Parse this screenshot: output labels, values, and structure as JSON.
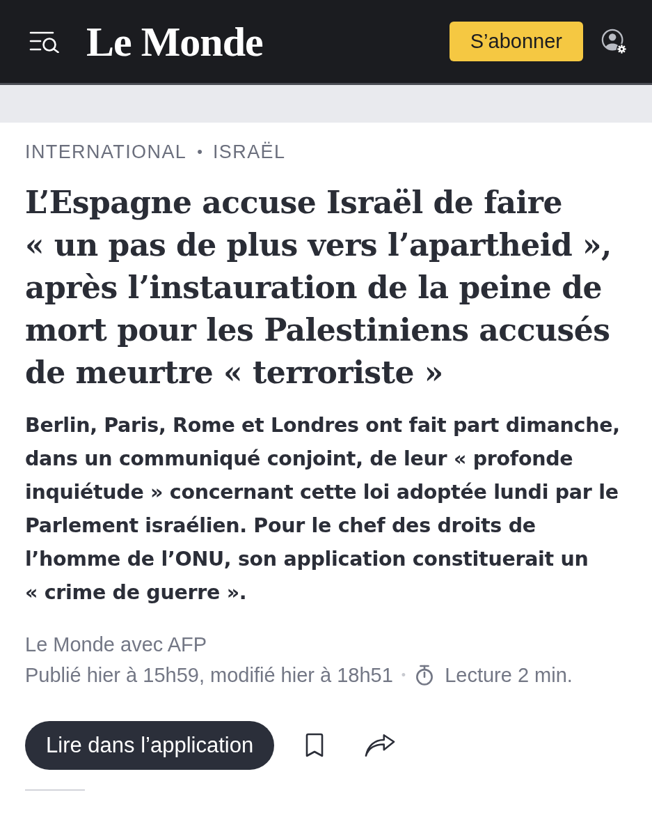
{
  "header": {
    "logo": "Le Monde",
    "subscribe_button": "S’abonner"
  },
  "article": {
    "section": "INTERNATIONAL",
    "separator": "•",
    "subsection": "ISRAËL",
    "title": "L’Espagne accuse Israël de faire « un pas de plus vers l’apartheid », après l’instauration de la peine de mort pour les Palestiniens accusés de meurtre « terroriste »",
    "standfirst": "Berlin, Paris, Rome et Londres ont fait part dimanche, dans un communiqué conjoint, de leur « profonde inquiétude » concernant cette loi adoptée lundi par le Parlement israélien. Pour le chef des droits de l’homme de l’ONU, son application constituerait un « crime de guerre ».",
    "author": "Le Monde avec AFP",
    "published": "Publié hier à 15h59, modifié hier à 18h51",
    "meta_separator": "•",
    "reading_time": "Lecture 2 min."
  },
  "actions": {
    "app_button": "Lire dans l’application"
  }
}
